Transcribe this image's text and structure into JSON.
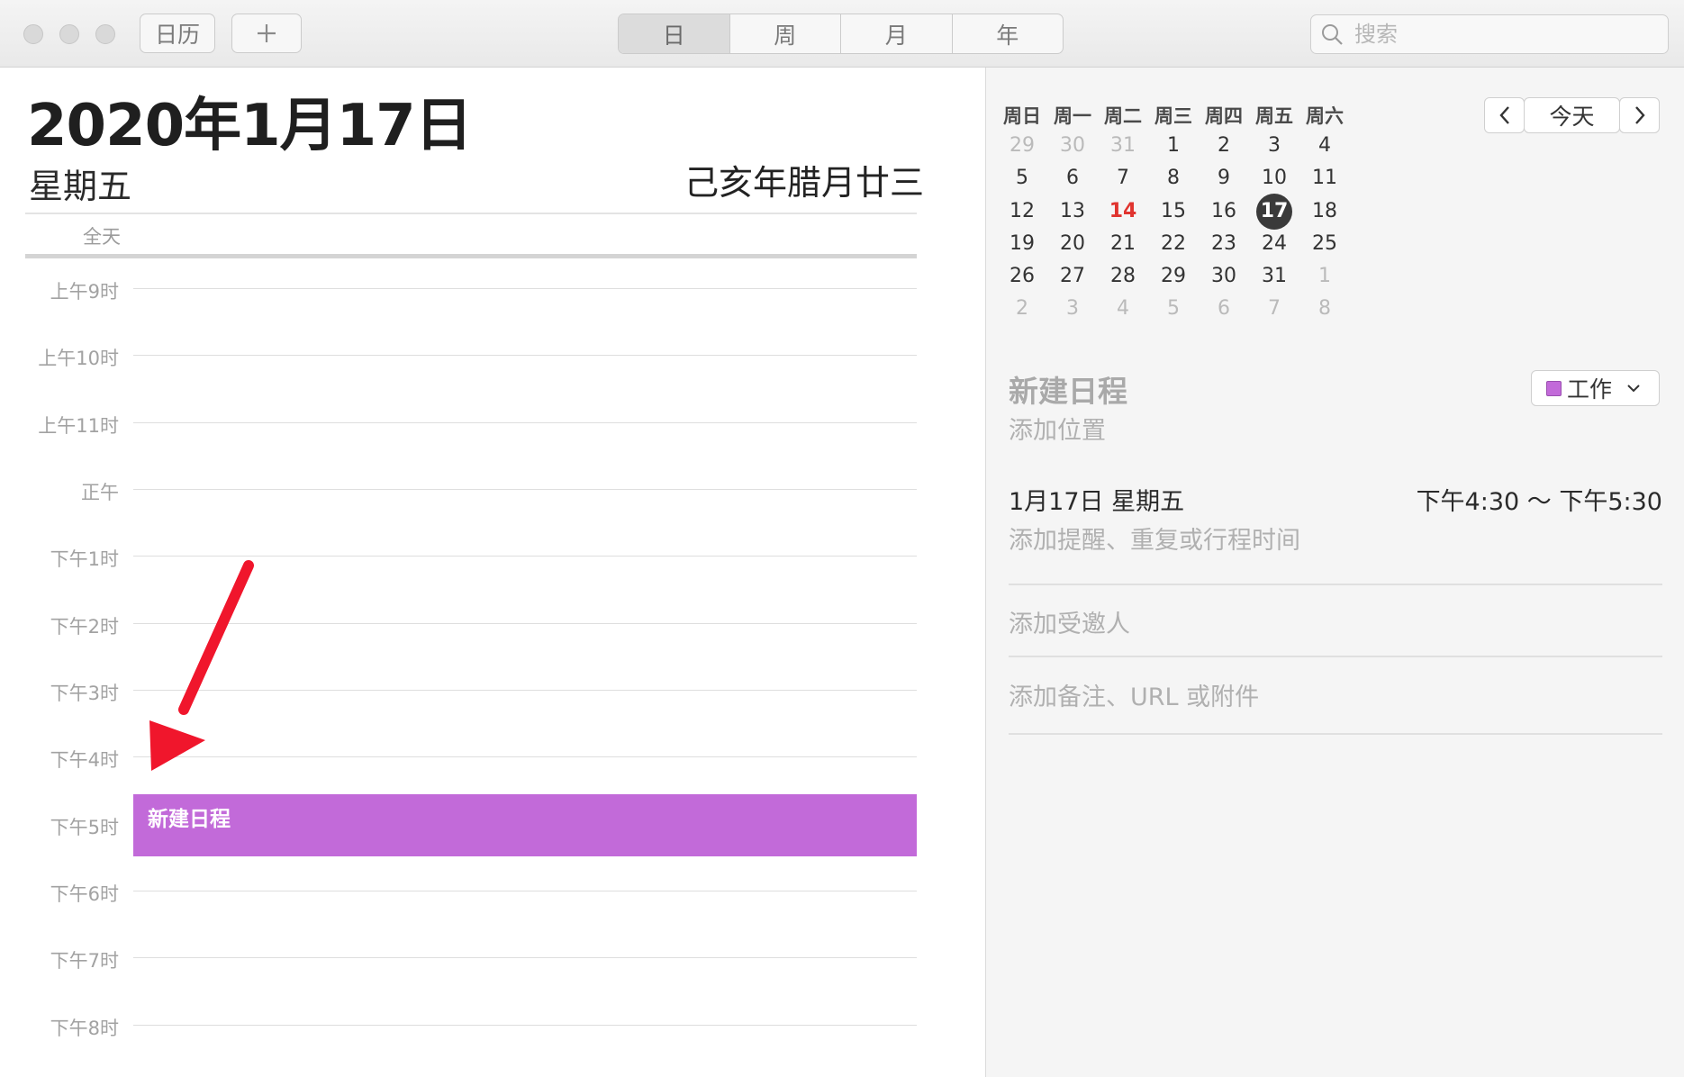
{
  "toolbar": {
    "calendars_label": "日历",
    "add_label": "+",
    "views": [
      "日",
      "周",
      "月",
      "年"
    ],
    "selected_view": "日",
    "search_placeholder": "搜索"
  },
  "day_view": {
    "date_title": "2020年1月17日",
    "weekday": "星期五",
    "lunar_date": "己亥年腊月廿三",
    "all_day_label": "全天",
    "hours": [
      "上午9时",
      "上午10时",
      "上午11时",
      "正午",
      "下午1时",
      "下午2时",
      "下午3时",
      "下午4时",
      "下午5时",
      "下午6时",
      "下午7时",
      "下午8时"
    ],
    "event": {
      "title": "新建日程",
      "color": "#c26ad9"
    }
  },
  "mini_calendar": {
    "weekday_headers": [
      "周日",
      "周一",
      "周二",
      "周三",
      "周四",
      "周五",
      "周六"
    ],
    "weeks": [
      [
        "29",
        "30",
        "31",
        "1",
        "2",
        "3",
        "4"
      ],
      [
        "5",
        "6",
        "7",
        "8",
        "9",
        "10",
        "11"
      ],
      [
        "12",
        "13",
        "14",
        "15",
        "16",
        "17",
        "18"
      ],
      [
        "19",
        "20",
        "21",
        "22",
        "23",
        "24",
        "25"
      ],
      [
        "26",
        "27",
        "28",
        "29",
        "30",
        "31",
        "1"
      ],
      [
        "2",
        "3",
        "4",
        "5",
        "6",
        "7",
        "8"
      ]
    ],
    "today_label": "今天",
    "prev_icon": "chevron-left-icon",
    "next_icon": "chevron-right-icon"
  },
  "event_detail": {
    "title": "新建日程",
    "location_placeholder": "添加位置",
    "calendar_name": "工作",
    "calendar_color": "#c26ad9",
    "date": "1月17日 星期五",
    "time": "下午4:30 ～ 下午5:30",
    "reminder_placeholder": "添加提醒、重复或行程时间",
    "invitees_placeholder": "添加受邀人",
    "notes_placeholder": "添加备注、URL 或附件"
  }
}
